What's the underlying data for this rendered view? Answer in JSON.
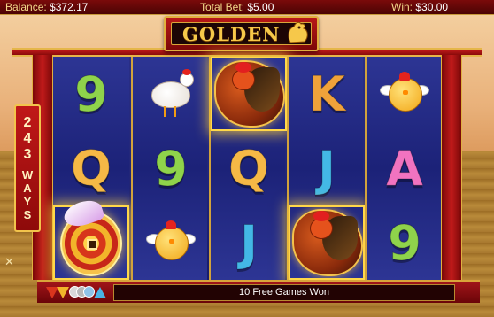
{
  "status": {
    "balance_label": "Balance:",
    "balance_value": "$372.17",
    "total_bet_label": "Total Bet:",
    "total_bet_value": "$5.00",
    "win_label": "Win:",
    "win_value": "$30.00"
  },
  "title": {
    "logo_text": "GOLDEN",
    "logo_icon": "rooster-icon"
  },
  "ways_banner": {
    "line1": "2",
    "line2": "4",
    "line3": "3",
    "w1": "W",
    "w2": "A",
    "w3": "Y",
    "w4": "S"
  },
  "reels": [
    {
      "symbols": [
        "9",
        "Q",
        "coin"
      ]
    },
    {
      "symbols": [
        "hen",
        "9",
        "chick"
      ]
    },
    {
      "symbols": [
        "rooster",
        "Q",
        "J"
      ]
    },
    {
      "symbols": [
        "K",
        "J",
        "rooster"
      ]
    },
    {
      "symbols": [
        "chick",
        "A",
        "9"
      ]
    }
  ],
  "reel_text": {
    "r1s1": "9",
    "r1s2": "Q",
    "r2s2": "9",
    "r3s2": "Q",
    "r3s3": "J",
    "r4s1": "K",
    "r4s2": "J",
    "r5s2": "A",
    "r5s3": "9"
  },
  "bottom_bar": {
    "message": "10 Free Games Won"
  },
  "colors": {
    "frame_red": "#c01a1a",
    "gold": "#e0b040",
    "reel_blue": "#1c2278"
  }
}
